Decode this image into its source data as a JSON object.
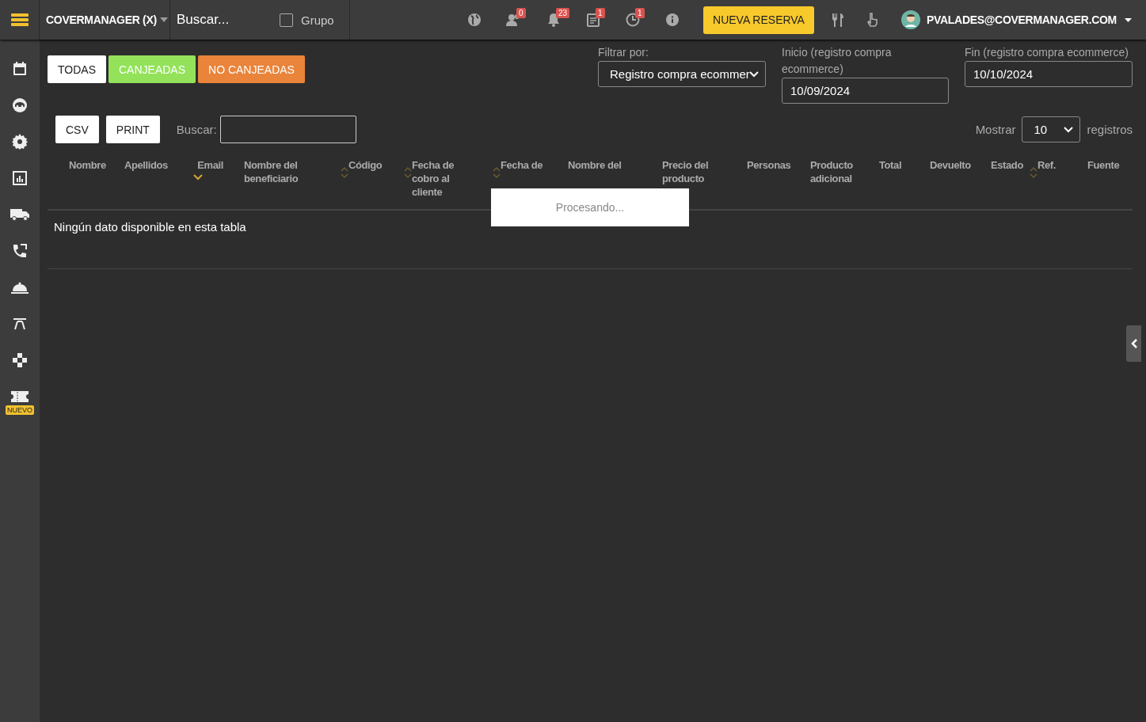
{
  "topbar": {
    "brand": "COVERMANAGER (X)",
    "search": {
      "placeholder": "Buscar..."
    },
    "group": {
      "label": "Grupo",
      "checked": false
    },
    "icons": [
      {
        "kind": "globe"
      },
      {
        "kind": "users",
        "badge": "0"
      },
      {
        "kind": "bell",
        "badge": "23"
      },
      {
        "kind": "clipboard",
        "badge": "1"
      },
      {
        "kind": "clock",
        "badge": "1"
      },
      {
        "kind": "info"
      }
    ],
    "new_button": "NUEVA RESERVA",
    "user": "PVALADES@COVERMANAGER.COM"
  },
  "sidebar": {
    "items": [
      {
        "kind": "calendar"
      },
      {
        "kind": "face"
      },
      {
        "kind": "gear"
      },
      {
        "kind": "chart"
      },
      {
        "kind": "truck"
      },
      {
        "kind": "phone"
      },
      {
        "kind": "cloche"
      },
      {
        "kind": "table"
      },
      {
        "kind": "puzzle"
      },
      {
        "kind": "ticket",
        "badge": "NUEVO"
      }
    ]
  },
  "status_tabs": [
    {
      "label": "TODAS",
      "kind": "all"
    },
    {
      "label": "CANJEADAS",
      "kind": "redeemed"
    },
    {
      "label": "NO CANJEADAS",
      "kind": "unredeemed"
    }
  ],
  "filters": {
    "filter_label": "Filtrar por:",
    "filter_value": "Registro compra ecommer",
    "start_label": "Inicio (registro compra ecommerce)",
    "start_value": "10/09/2024",
    "end_label": "Fin (registro compra ecommerce)",
    "end_value": "10/10/2024"
  },
  "toolbar": {
    "buttons": [
      "CSV",
      "PRINT"
    ],
    "search_label": "Buscar:",
    "show_label": "Mostrar",
    "show_value": "10",
    "show_suffix": "registros"
  },
  "table": {
    "columns": [
      {
        "label": "Nombre",
        "sortable": false,
        "sorted": false
      },
      {
        "label": "Apellidos",
        "sortable": false,
        "sorted": false
      },
      {
        "label": "Email",
        "sortable": true,
        "sorted": true
      },
      {
        "label": "Nombre del beneficiario",
        "sortable": false,
        "sorted": false
      },
      {
        "label": "Código",
        "sortable": true,
        "sorted": false
      },
      {
        "label": "Fecha de cobro al cliente",
        "sortable": true,
        "sorted": false
      },
      {
        "label": "Fecha de",
        "sortable": true,
        "sorted": false
      },
      {
        "label": "Nombre del",
        "sortable": false,
        "sorted": false
      },
      {
        "label": "Precio del producto",
        "sortable": false,
        "sorted": false
      },
      {
        "label": "Personas",
        "sortable": false,
        "sorted": false
      },
      {
        "label": "Producto adicional",
        "sortable": false,
        "sorted": false
      },
      {
        "label": "Total",
        "sortable": false,
        "sorted": false
      },
      {
        "label": "Devuelto",
        "sortable": false,
        "sorted": false
      },
      {
        "label": "Estado",
        "sortable": false,
        "sorted": false
      },
      {
        "label": "Ref.",
        "sortable": true,
        "sorted": false
      },
      {
        "label": "Fuente",
        "sortable": false,
        "sorted": false
      }
    ],
    "empty": "Ningún dato disponible en esta tabla",
    "processing": "Procesando..."
  }
}
